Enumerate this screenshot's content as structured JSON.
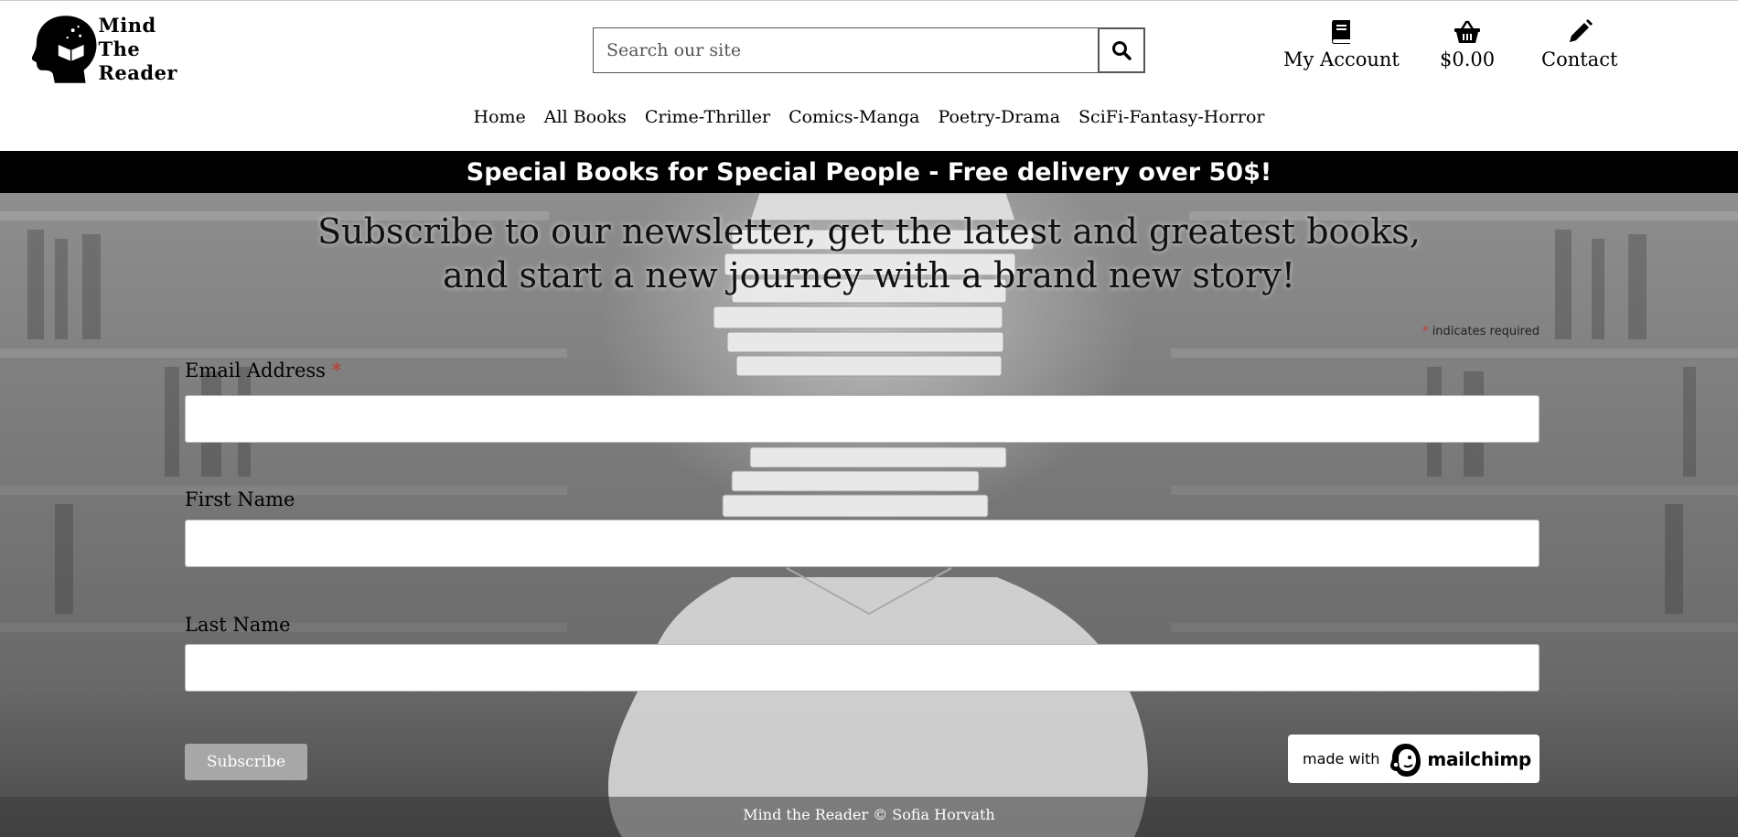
{
  "brand": {
    "logo_icon": "head-with-book-icon",
    "logo_lines": [
      "Mind",
      "The",
      "Reader"
    ]
  },
  "search": {
    "placeholder": "Search our site",
    "button_icon": "search-icon"
  },
  "top_links": [
    {
      "label": "My Account",
      "icon": "book-icon"
    },
    {
      "label": "$0.00",
      "icon": "basket-icon"
    },
    {
      "label": "Contact",
      "icon": "pencil-icon"
    }
  ],
  "nav": [
    "Home",
    "All Books",
    "Crime-Thriller",
    "Comics-Manga",
    "Poetry-Drama",
    "SciFi-Fantasy-Horror"
  ],
  "promo": "Special Books for Special People - Free delivery over 50$!",
  "newsletter": {
    "title_line1": "Subscribe to our newsletter, get the latest and greatest books,",
    "title_line2": "and start a new journey with a brand new story!",
    "required_star": "*",
    "required_note": "indicates required",
    "fields": [
      {
        "label": "Email Address",
        "required": true,
        "value": ""
      },
      {
        "label": "First Name",
        "required": false,
        "value": ""
      },
      {
        "label": "Last Name",
        "required": false,
        "value": ""
      }
    ],
    "subscribe_label": "Subscribe",
    "badge_prefix": "made with",
    "badge_brand": "mailchimp",
    "badge_icon": "mailchimp-freddie-icon"
  },
  "footer": "Mind the Reader © Sofia Horvath",
  "colors": {
    "promo_bg": "#000000",
    "required": "#c0392b",
    "subscribe_bg": "#a7a7a7"
  }
}
